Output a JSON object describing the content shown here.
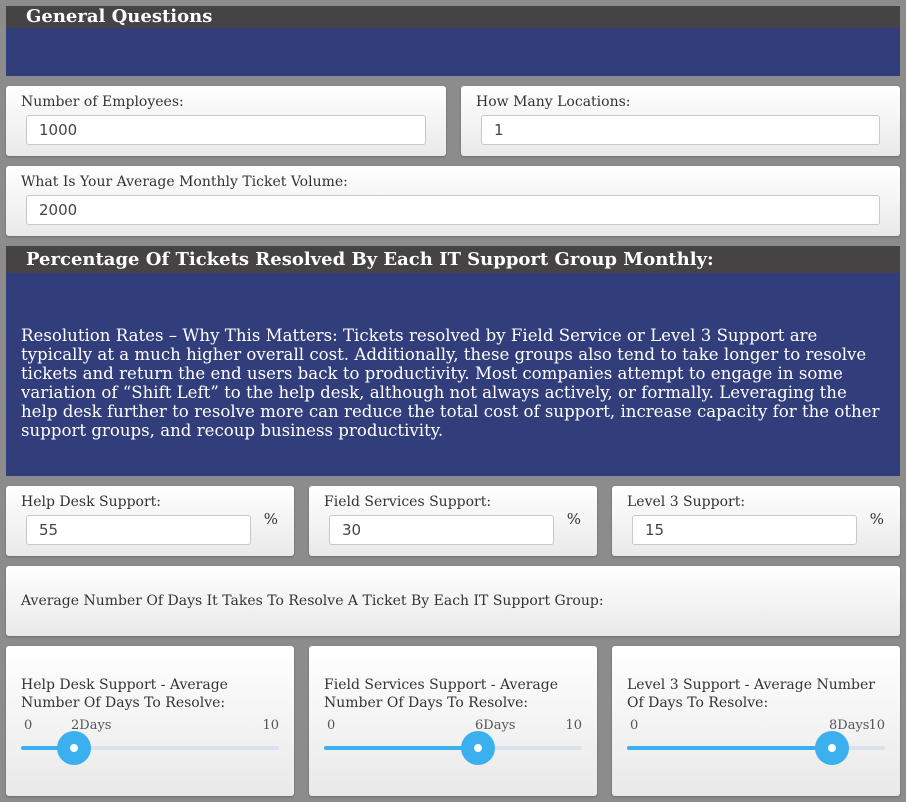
{
  "general": {
    "title": "General Questions",
    "employees": {
      "label": "Number of Employees:",
      "value": "1000"
    },
    "locations": {
      "label": "How Many Locations:",
      "value": "1"
    },
    "tickets": {
      "label": "What Is Your Average Monthly Ticket Volume:",
      "value": "2000"
    }
  },
  "percentages": {
    "title": "Percentage Of Tickets Resolved By Each IT Support Group Monthly:",
    "description": "Resolution Rates – Why This Matters: Tickets resolved by Field Service or Level 3 Support are typically at a much higher overall cost. Additionally, these groups also tend to take longer to resolve tickets and return the end users back to productivity. Most companies attempt to engage in some variation of “Shift Left” to the help desk, although not always actively, or formally. Leveraging the help desk further to resolve more can reduce the total cost of support, increase capacity for the other support groups, and recoup business productivity.",
    "percent_symbol": "%",
    "fields": [
      {
        "label": "Help Desk Support:",
        "value": "55"
      },
      {
        "label": "Field Services Support:",
        "value": "30"
      },
      {
        "label": "Level 3 Support:",
        "value": "15"
      }
    ]
  },
  "days": {
    "heading": "Average Number Of Days It Takes To Resolve A Ticket By Each IT Support Group:",
    "min_label": "0",
    "max_label": "10",
    "min": 0,
    "max": 10,
    "sliders": [
      {
        "label": "Help Desk Support - Average Number Of Days To Resolve:",
        "value": 2,
        "display": "2Days"
      },
      {
        "label": "Field Services Support - Average Number Of Days To Resolve:",
        "value": 6,
        "display": "6Days"
      },
      {
        "label": "Level 3 Support - Average Number Of Days To Resolve:",
        "value": 8,
        "display": "8Days"
      }
    ]
  },
  "colors": {
    "header_bg": "#454344",
    "panel_blue": "#323d7b",
    "slider_accent": "#3ab0ee"
  }
}
